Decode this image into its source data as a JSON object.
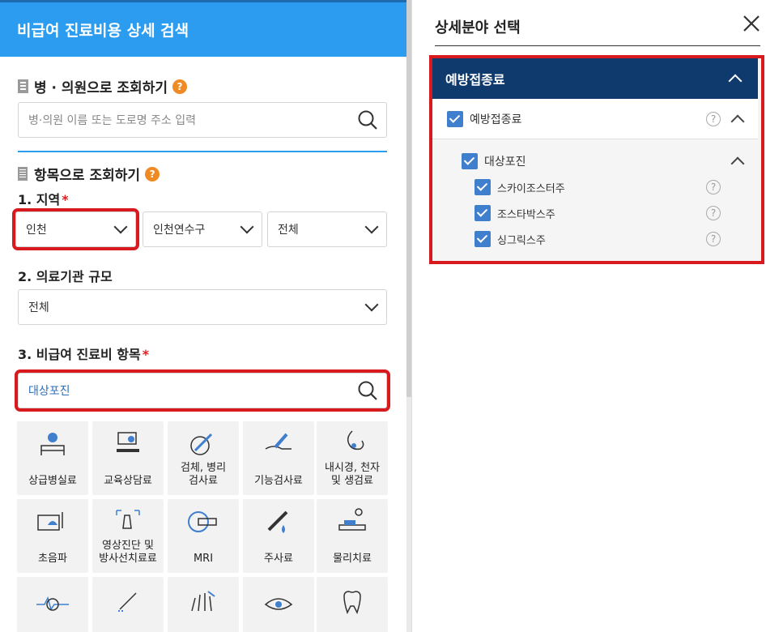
{
  "left": {
    "header": "비급여 진료비용 상세 검색",
    "section1": {
      "title": "병 · 의원으로 조회하기",
      "help": "?",
      "placeholder": "병·의원 이름 또는 도로명 주소 입력"
    },
    "section2": {
      "title": "항목으로 조회하기",
      "help": "?",
      "region_label": "1. 지역",
      "region_req": "*",
      "region_values": [
        "인천",
        "인천연수구",
        "전체"
      ],
      "scale_label": "2. 의료기관 규모",
      "scale_value": "전체",
      "item_label": "3. 비급여 진료비 항목",
      "item_req": "*",
      "item_value": "대상포진"
    },
    "tiles": [
      {
        "label": "상급병실료",
        "icon": "hospital-bed-icon"
      },
      {
        "label": "교육상담료",
        "icon": "consultation-icon"
      },
      {
        "label": "검체, 병리\n검사료",
        "icon": "lab-test-icon"
      },
      {
        "label": "기능검사료",
        "icon": "function-test-icon"
      },
      {
        "label": "내시경, 천자\n및 생검료",
        "icon": "endoscopy-icon"
      },
      {
        "label": "초음파",
        "icon": "ultrasound-icon"
      },
      {
        "label": "영상진단 및\n방사선치료료",
        "icon": "imaging-icon"
      },
      {
        "label": "MRI",
        "icon": "mri-icon"
      },
      {
        "label": "주사료",
        "icon": "injection-icon"
      },
      {
        "label": "물리치료",
        "icon": "physical-therapy-icon"
      },
      {
        "label": "",
        "icon": "heart-rhythm-icon"
      },
      {
        "label": "",
        "icon": "surgery-hand-icon"
      },
      {
        "label": "",
        "icon": "hair-transplant-icon"
      },
      {
        "label": "",
        "icon": "eye-icon"
      },
      {
        "label": "",
        "icon": "tooth-icon"
      }
    ]
  },
  "right": {
    "title": "상세분야 선택",
    "category": "예방접종료",
    "group": "예방접종료",
    "subgroup": "대상포진",
    "items": [
      "스카이조스터주",
      "조스타박스주",
      "싱그릭스주"
    ],
    "help": "?"
  },
  "colors": {
    "header_blue": "#2b9cf0",
    "navy": "#0f3a6e",
    "highlight_red": "#d8191e",
    "check_blue": "#3f7fce",
    "help_orange": "#f08a24"
  }
}
